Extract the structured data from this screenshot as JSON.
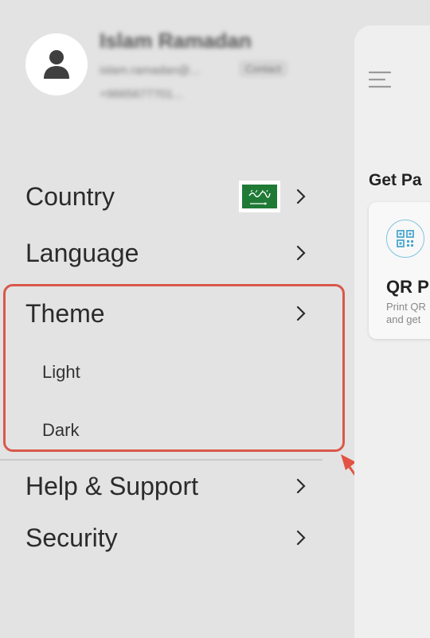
{
  "profile": {
    "name": "Islam Ramadan",
    "email": "islam.ramadan@...",
    "badge": "Contact",
    "phone": "+9665677701..."
  },
  "menu": {
    "country": "Country",
    "language": "Language",
    "theme": "Theme",
    "theme_options": [
      "Light",
      "Dark"
    ],
    "help": "Help & Support",
    "security": "Security"
  },
  "flag": {
    "inscription": "لا إله إلا الله",
    "country": "Saudi Arabia"
  },
  "background_app": {
    "section_title": "Get Pa",
    "card_title": "QR P",
    "card_desc_line1": "Print QR",
    "card_desc_line2": "and get"
  },
  "colors": {
    "drawer_bg": "#e3e3e3",
    "highlight_border": "#d9584a",
    "flag_green": "#1f7a35",
    "qr_accent": "#4aa7cf"
  }
}
